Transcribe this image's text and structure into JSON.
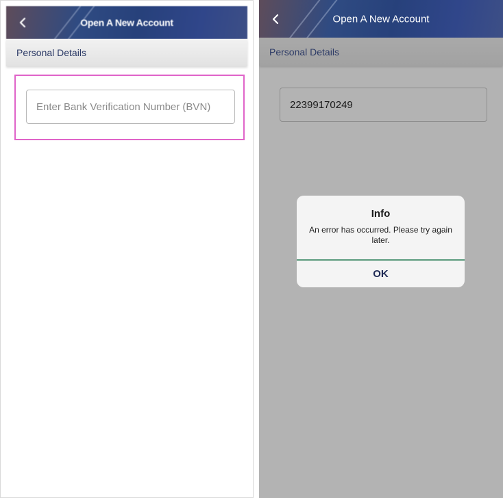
{
  "header": {
    "title": "Open A New Account",
    "back_icon": "chevron-left-icon"
  },
  "section": {
    "label": "Personal Details"
  },
  "left_screen": {
    "bvn_input": {
      "placeholder": "Enter Bank Verification Number (BVN)",
      "value": ""
    }
  },
  "right_screen": {
    "bvn_input": {
      "placeholder": "Enter Bank Verification Number (BVN)",
      "value": "22399170249"
    },
    "dialog": {
      "title": "Info",
      "message": "An error has occurred. Please try again later.",
      "ok_label": "OK"
    }
  },
  "colors": {
    "header_navy": "#27417b",
    "highlight": "#e064c9",
    "section_text": "#2c3a66",
    "dialog_separator": "#5a9a7c",
    "overlay_grey": "#b3b3b3"
  }
}
